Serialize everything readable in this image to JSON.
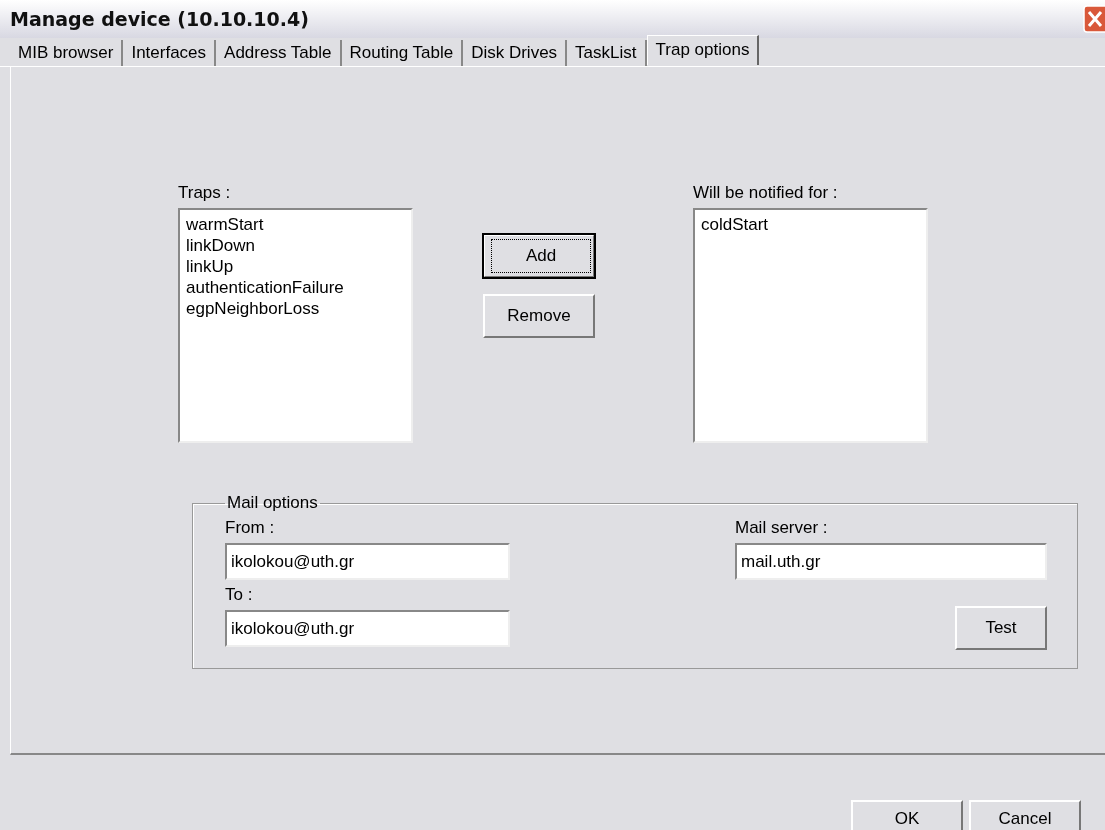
{
  "window": {
    "title": "Manage device (10.10.10.4)"
  },
  "tabs": [
    {
      "label": "MIB browser",
      "selected": false
    },
    {
      "label": "Interfaces",
      "selected": false
    },
    {
      "label": "Address Table",
      "selected": false
    },
    {
      "label": "Routing Table",
      "selected": false
    },
    {
      "label": "Disk Drives",
      "selected": false
    },
    {
      "label": "TaskList",
      "selected": false
    },
    {
      "label": "Trap options",
      "selected": true
    }
  ],
  "traps": {
    "label": "Traps :",
    "items": [
      "warmStart",
      "linkDown",
      "linkUp",
      "authenticationFailure",
      "egpNeighborLoss"
    ]
  },
  "move_buttons": [
    {
      "label": "Add",
      "focused": true
    },
    {
      "label": "Remove",
      "focused": false
    }
  ],
  "notified": {
    "label": "Will be notified for :",
    "items": [
      "coldStart"
    ]
  },
  "mail_options": {
    "title": "Mail options",
    "from": {
      "label": "From :",
      "value": "ikolokou@uth.gr"
    },
    "to": {
      "label": "To :",
      "value": "ikolokou@uth.gr"
    },
    "server": {
      "label": "Mail server :",
      "value": "mail.uth.gr"
    },
    "test_button": "Test"
  },
  "buttons": [
    "OK",
    "Cancel"
  ]
}
